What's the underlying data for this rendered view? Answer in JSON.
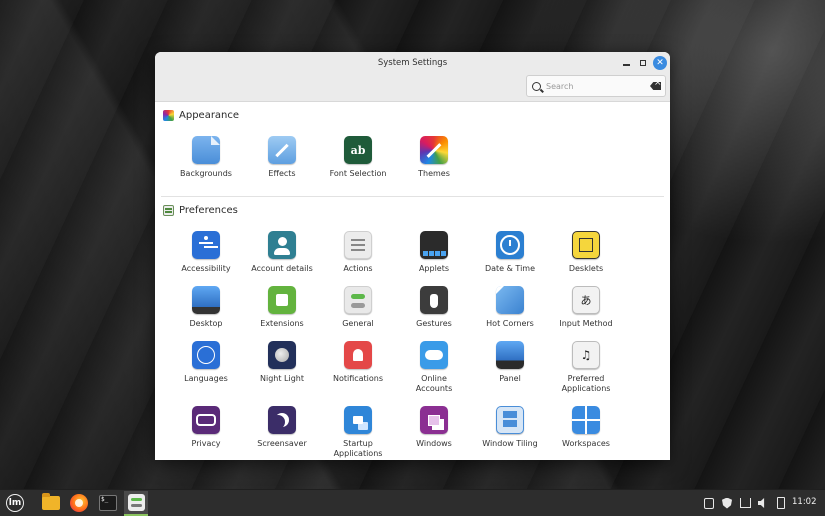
{
  "window": {
    "title": "System Settings",
    "search_placeholder": "Search"
  },
  "sections": {
    "appearance": {
      "title": "Appearance",
      "items": [
        {
          "label": "Backgrounds",
          "icon": "backgrounds-icon"
        },
        {
          "label": "Effects",
          "icon": "effects-icon"
        },
        {
          "label": "Font Selection",
          "icon": "font-selection-icon"
        },
        {
          "label": "Themes",
          "icon": "themes-icon"
        }
      ]
    },
    "preferences": {
      "title": "Preferences",
      "items": [
        {
          "label": "Accessibility",
          "icon": "accessibility-icon"
        },
        {
          "label": "Account details",
          "icon": "account-details-icon"
        },
        {
          "label": "Actions",
          "icon": "actions-icon"
        },
        {
          "label": "Applets",
          "icon": "applets-icon"
        },
        {
          "label": "Date & Time",
          "icon": "date-time-icon"
        },
        {
          "label": "Desklets",
          "icon": "desklets-icon"
        },
        {
          "label": "Desktop",
          "icon": "desktop-icon"
        },
        {
          "label": "Extensions",
          "icon": "extensions-icon"
        },
        {
          "label": "General",
          "icon": "general-icon"
        },
        {
          "label": "Gestures",
          "icon": "gestures-icon"
        },
        {
          "label": "Hot Corners",
          "icon": "hot-corners-icon"
        },
        {
          "label": "Input Method",
          "icon": "input-method-icon"
        },
        {
          "label": "Languages",
          "icon": "languages-icon"
        },
        {
          "label": "Night Light",
          "icon": "night-light-icon"
        },
        {
          "label": "Notifications",
          "icon": "notifications-icon"
        },
        {
          "label": "Online Accounts",
          "icon": "online-accounts-icon"
        },
        {
          "label": "Panel",
          "icon": "panel-icon"
        },
        {
          "label": "Preferred Applications",
          "icon": "preferred-applications-icon"
        },
        {
          "label": "Privacy",
          "icon": "privacy-icon"
        },
        {
          "label": "Screensaver",
          "icon": "screensaver-icon"
        },
        {
          "label": "Startup Applications",
          "icon": "startup-applications-icon"
        },
        {
          "label": "Windows",
          "icon": "windows-icon"
        },
        {
          "label": "Window Tiling",
          "icon": "window-tiling-icon"
        },
        {
          "label": "Workspaces",
          "icon": "workspaces-icon"
        }
      ]
    }
  },
  "icons": {
    "font_selection_glyph": "ab",
    "input_method_glyph": "あ",
    "preferred_apps_glyph": "♫",
    "terminal_glyph": "$_"
  },
  "taskbar": {
    "clock": "11:02"
  }
}
